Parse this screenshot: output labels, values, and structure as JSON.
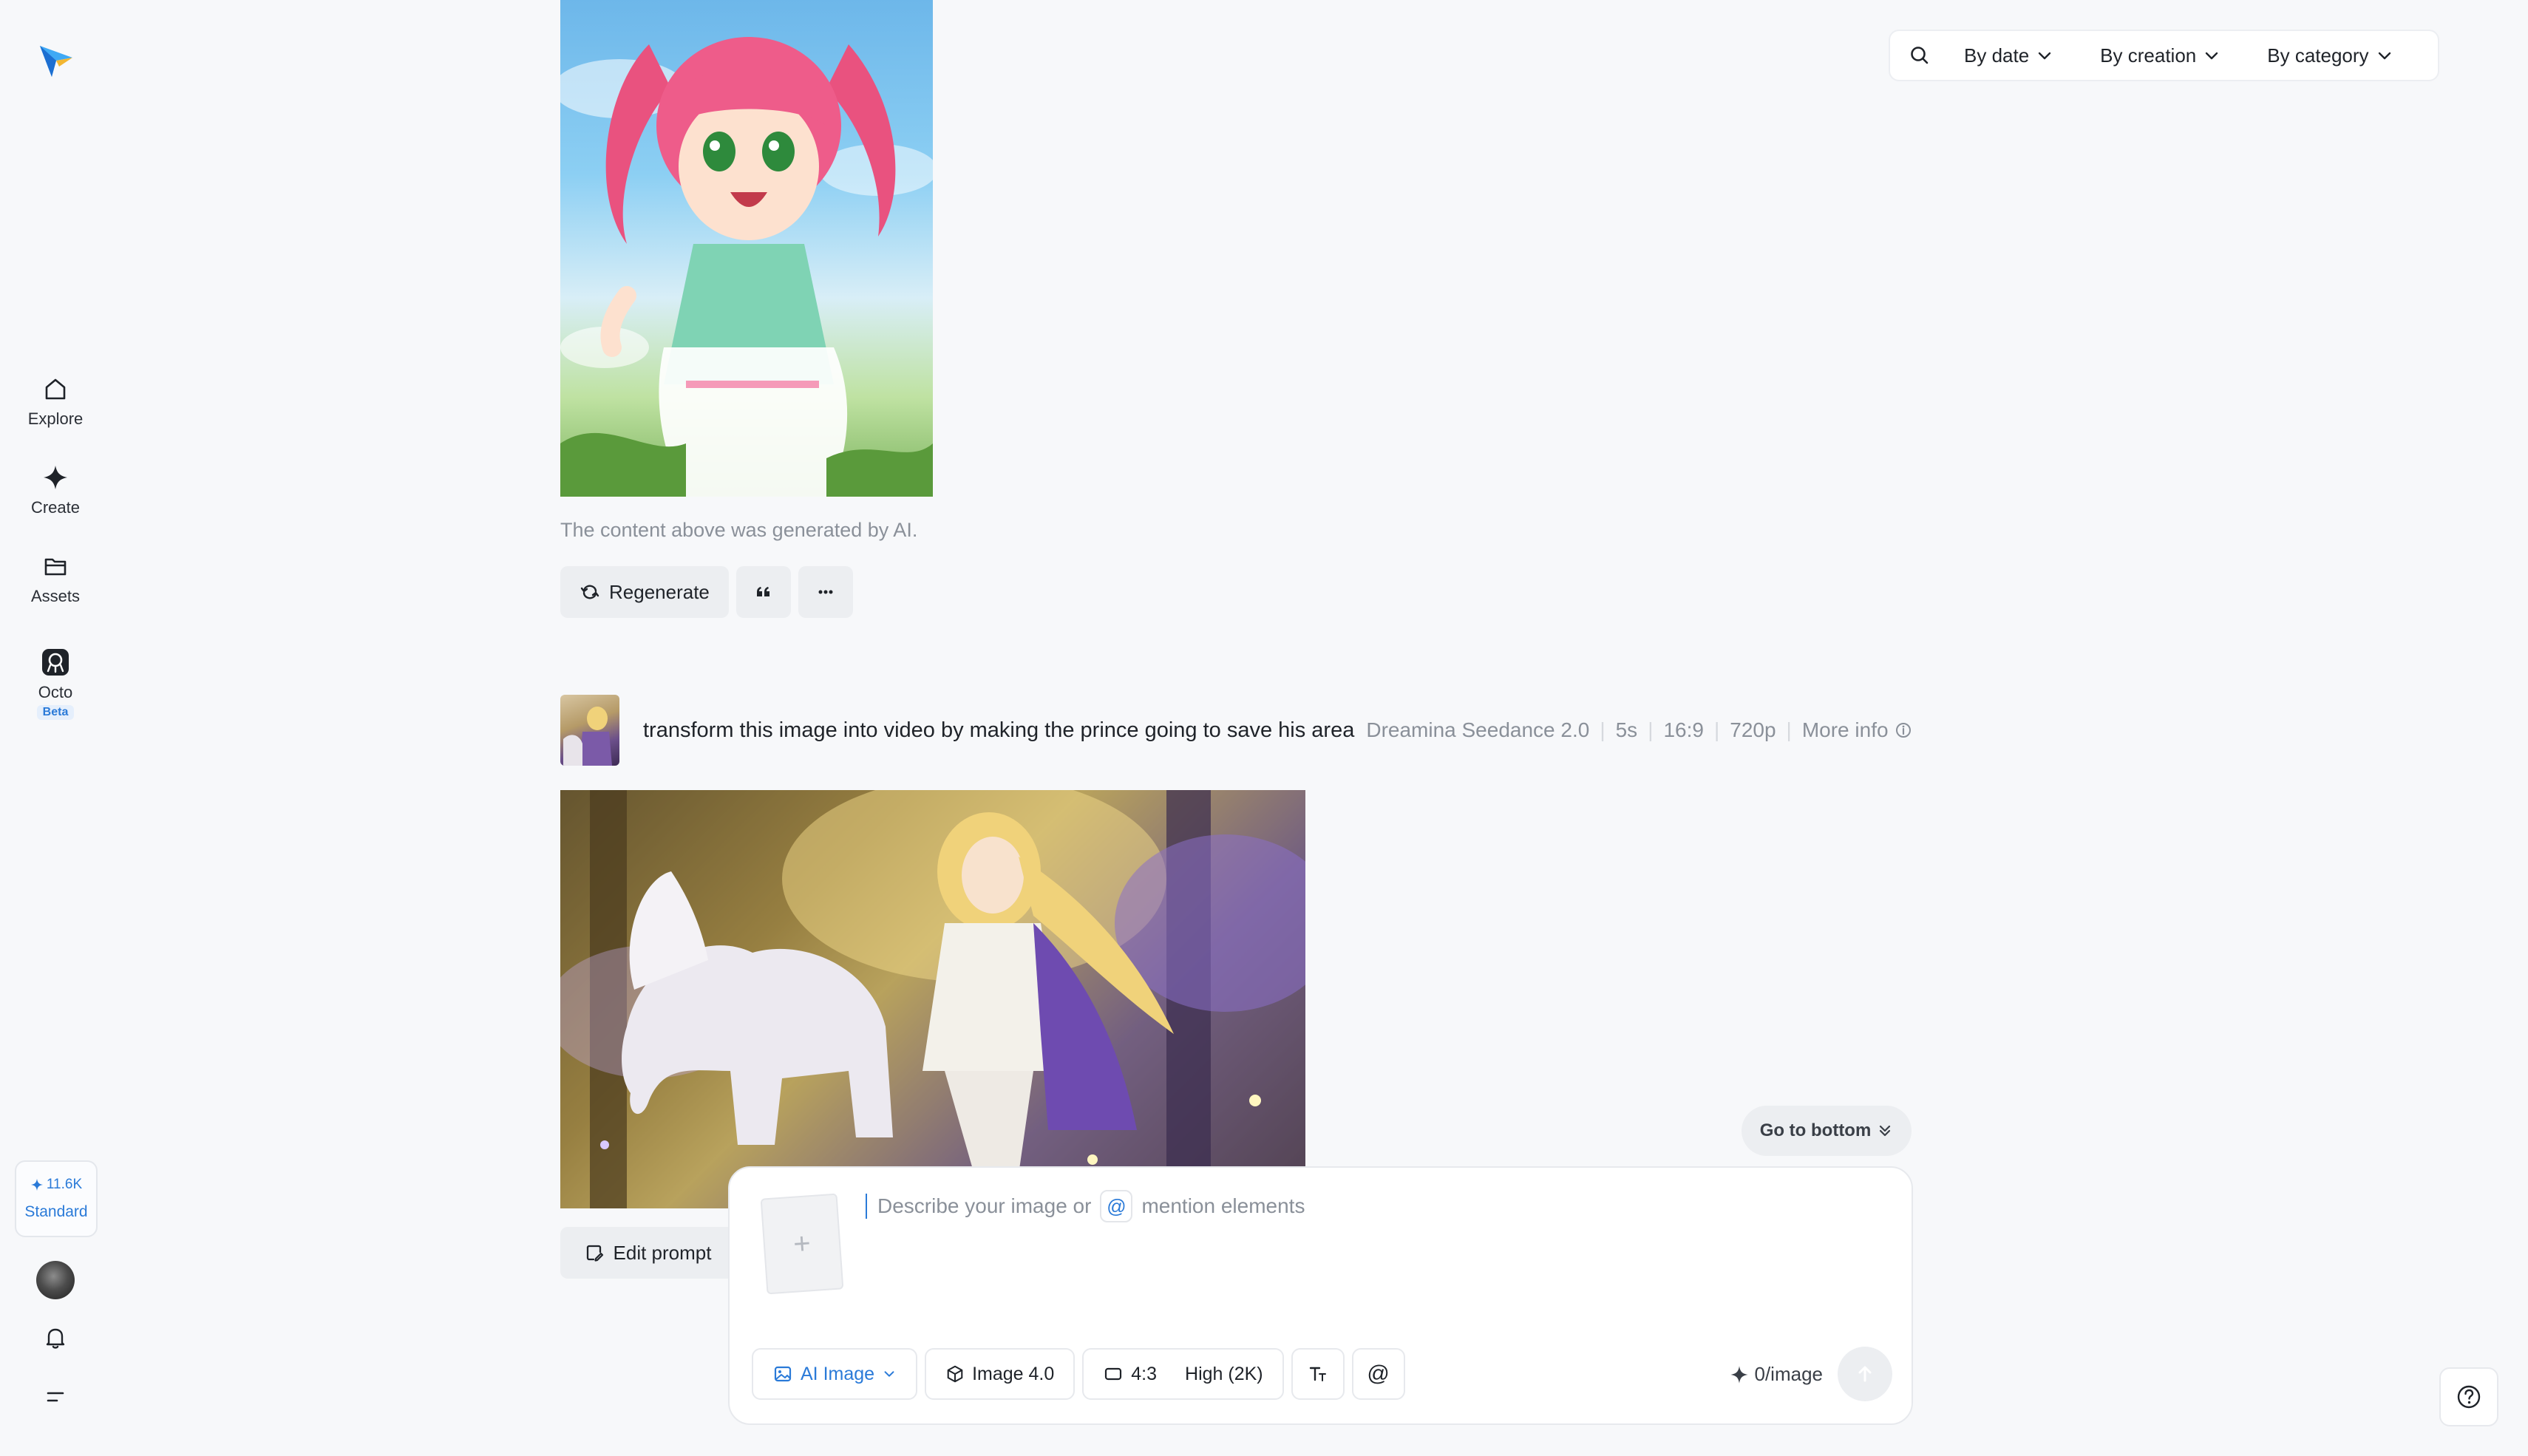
{
  "sidebar": {
    "items": [
      {
        "label": "Explore",
        "icon": "home-icon"
      },
      {
        "label": "Create",
        "icon": "sparkle-icon"
      },
      {
        "label": "Assets",
        "icon": "folder-icon"
      },
      {
        "label": "Octo",
        "icon": "octo-icon",
        "badge": "Beta"
      }
    ],
    "credits": {
      "amount": "11.6K",
      "plan": "Standard"
    }
  },
  "filters": {
    "date": "By date",
    "creation": "By creation",
    "category": "By category"
  },
  "first_result": {
    "ai_note": "The content above was generated by AI.",
    "regenerate_label": "Regenerate"
  },
  "second_result": {
    "prompt": "transform this image into video by making the prince going to save his area",
    "model": "Dreamina Seedance 2.0",
    "duration": "5s",
    "ratio": "16:9",
    "resolution": "720p",
    "more_info": "More info",
    "edit_prompt_label": "Edit prompt"
  },
  "go_to_bottom": "Go to bottom",
  "composer": {
    "placeholder_start": "Describe your image or",
    "placeholder_end": "mention elements",
    "mode": "AI Image",
    "model": "Image 4.0",
    "ratio": "4:3",
    "quality": "High (2K)",
    "cost": "0/image"
  },
  "colors": {
    "accent": "#2a7ad8",
    "background": "#f7f8fa"
  }
}
